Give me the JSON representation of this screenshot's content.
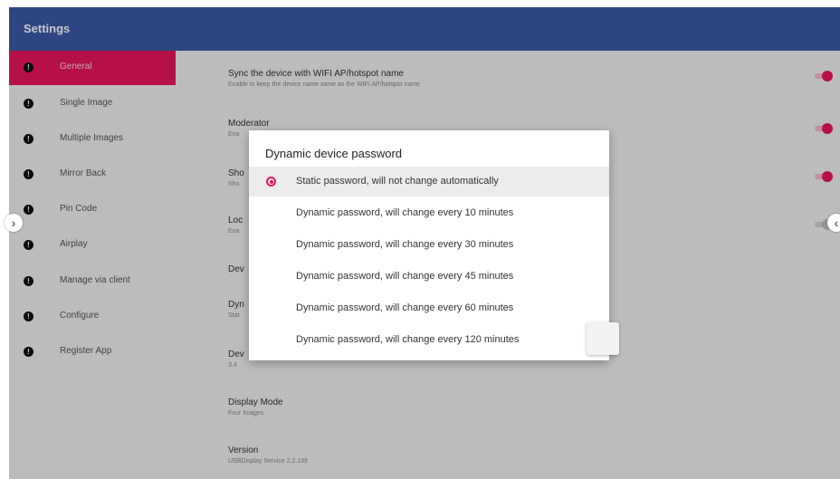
{
  "app": {
    "title": "Settings"
  },
  "sidebar": {
    "items": [
      {
        "label": "General",
        "active": true
      },
      {
        "label": "Single Image"
      },
      {
        "label": "Multiple Images"
      },
      {
        "label": "Mirror Back"
      },
      {
        "label": "Pin Code"
      },
      {
        "label": "Airplay"
      },
      {
        "label": "Manage via client"
      },
      {
        "label": "Configure"
      },
      {
        "label": "Register App"
      }
    ]
  },
  "settings": [
    {
      "title": "Sync the device with WIFI AP/hotspot name",
      "subtitle": "Enable to keep the device name same as the WIFI AP/hotspot name",
      "toggle": "on"
    },
    {
      "title": "Moderator",
      "subtitle": "Ena",
      "toggle": "on"
    },
    {
      "title": "Sho",
      "subtitle": "Sho",
      "toggle": "on"
    },
    {
      "title": "Loc",
      "subtitle": "Ena",
      "toggle": "off"
    },
    {
      "title": "Dev",
      "subtitle": ""
    },
    {
      "title": "Dyn",
      "subtitle": "Stat"
    },
    {
      "title": "Dev",
      "subtitle": "3.4"
    },
    {
      "title": "Display Mode",
      "subtitle": "Four Images"
    },
    {
      "title": "Version",
      "subtitle": "USBDisplay Service 2.2.199"
    }
  ],
  "dialog": {
    "title": "Dynamic device password",
    "options": [
      {
        "label": "Static password, will not change automatically",
        "selected": true
      },
      {
        "label": "Dynamic password, will change every 10 minutes"
      },
      {
        "label": "Dynamic password, will change every 30 minutes"
      },
      {
        "label": "Dynamic password, will change every 45 minutes"
      },
      {
        "label": "Dynamic password, will change every 60 minutes"
      },
      {
        "label": "Dynamic password, will change every 120 minutes"
      }
    ]
  },
  "icons": {
    "info": "info-icon",
    "edge_left": "chevron-right-icon",
    "edge_right": "chevron-left-icon"
  },
  "colors": {
    "accent": "#e8175d",
    "topbar": "#3a5aa8"
  }
}
